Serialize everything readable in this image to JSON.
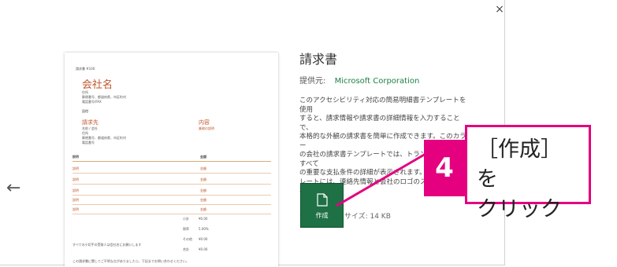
{
  "dialog": {
    "close_icon": "×",
    "back_icon": "←"
  },
  "preview": {
    "invoice_no": "請求書 #100",
    "company_name": "会社名",
    "address_lines": [
      "住所",
      "郵便番号、都道府県、市区町村",
      "電話番号/FAX"
    ],
    "date_label": "日付",
    "bill_to_label": "請求先",
    "bill_to_lines": [
      "名前 / 会社",
      "住所",
      "郵便番号、都道府県、市区町村",
      "電話番号"
    ],
    "content_label": "内容",
    "content_sub": "業務の説明",
    "table_headers": [
      "説明",
      "金額"
    ],
    "rows": [
      {
        "desc": "説明",
        "amount": "金額"
      },
      {
        "desc": "説明",
        "amount": "金額"
      },
      {
        "desc": "説明",
        "amount": "金額"
      },
      {
        "desc": "説明",
        "amount": "金額"
      },
      {
        "desc": "説明",
        "amount": "金額"
      }
    ],
    "totals": [
      {
        "label": "小計",
        "value": "¥0.00"
      },
      {
        "label": "税率",
        "value": "5.00%"
      },
      {
        "label": "その他",
        "value": "¥0.00"
      },
      {
        "label": "合計",
        "value": "¥0.00"
      }
    ],
    "footer_lines": [
      "すべての小切手の受取人は会社名にお願いします",
      "この請求書に関してご不明な点がありましたら、下記までお問い合わせください。"
    ]
  },
  "info": {
    "title": "請求書",
    "provider_label": "提供元:",
    "provider_name": "Microsoft Corporation",
    "description": "このアクセシビリティ対応の簡易明細書テンプレートを使用\nすると、請求情報や請求書の詳細情報を入力することで、\n本格的な外観の請求書を簡単に作成できます。このカラー\nの会社の請求書テンプレートでは、トランザクションのすべて\nの重要な支払条件の詳細が表示されます。請求書テンプ\nレートには、連絡先情報と会社のロゴのスペース\nれています。",
    "download_size": "ダウンロード サイズ:  14 KB"
  },
  "create_button": {
    "label": "作成"
  },
  "callout": {
    "number": "4",
    "line1": "［作成］を",
    "line2": "クリック",
    "color": "#e4007f"
  }
}
